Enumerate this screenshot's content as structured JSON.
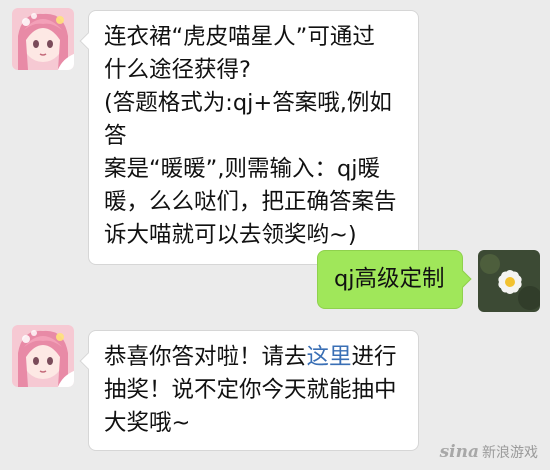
{
  "messages": [
    {
      "side": "incoming",
      "lines": [
        "连衣裙“虎皮喵星人”可通过",
        "什么途径获得?",
        "(答题格式为:qj+答案哦,例如答",
        "案是“暖暖”,则需输入：qj暖",
        "暖，么么哒们，把正确答案告",
        "诉大喵就可以去领奖哟~)"
      ]
    },
    {
      "side": "outgoing",
      "text": "qj高级定制"
    },
    {
      "side": "incoming",
      "line1_before": "恭喜你答对啦！请去",
      "line1_link": "这里",
      "line1_after": "进行",
      "line2": "抽奖！说不定你今天就能抽中",
      "line3": "大奖哦~"
    }
  ],
  "watermark": {
    "logo": "sina",
    "text": "新浪游戏"
  },
  "colors": {
    "background": "#ebebeb",
    "incoming_bubble": "#ffffff",
    "outgoing_bubble": "#a0e75a",
    "link": "#3a6fb5"
  },
  "icons": {
    "bot_avatar": "anime-girl-avatar",
    "bot_badge": "tencent-game-badge",
    "user_avatar": "white-flower-avatar"
  }
}
